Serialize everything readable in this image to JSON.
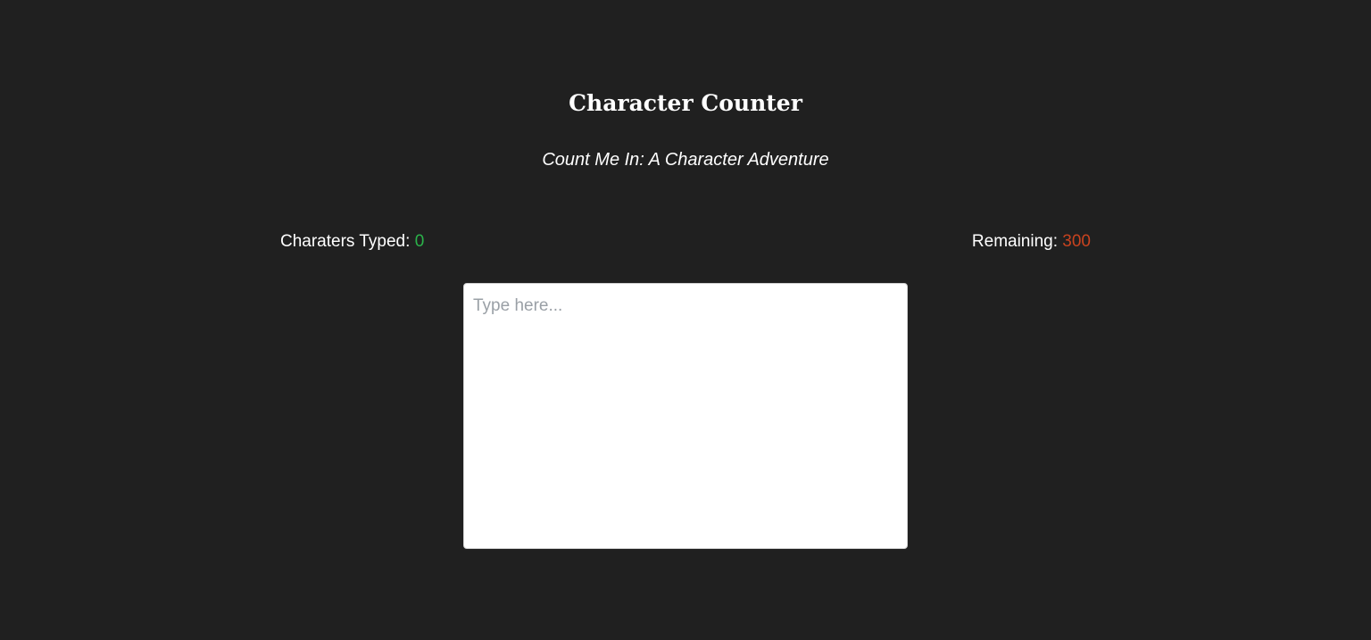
{
  "header": {
    "title": "Character Counter",
    "subtitle": "Count Me In: A Character Adventure"
  },
  "stats": {
    "typed_label": "Charaters Typed:",
    "typed_value": "0",
    "remaining_label": "Remaining:",
    "remaining_value": "300"
  },
  "editor": {
    "value": "",
    "placeholder": "Type here..."
  },
  "colors": {
    "background": "#202020",
    "typed_accent": "#2bb34a",
    "remaining_accent": "#c8431f"
  }
}
